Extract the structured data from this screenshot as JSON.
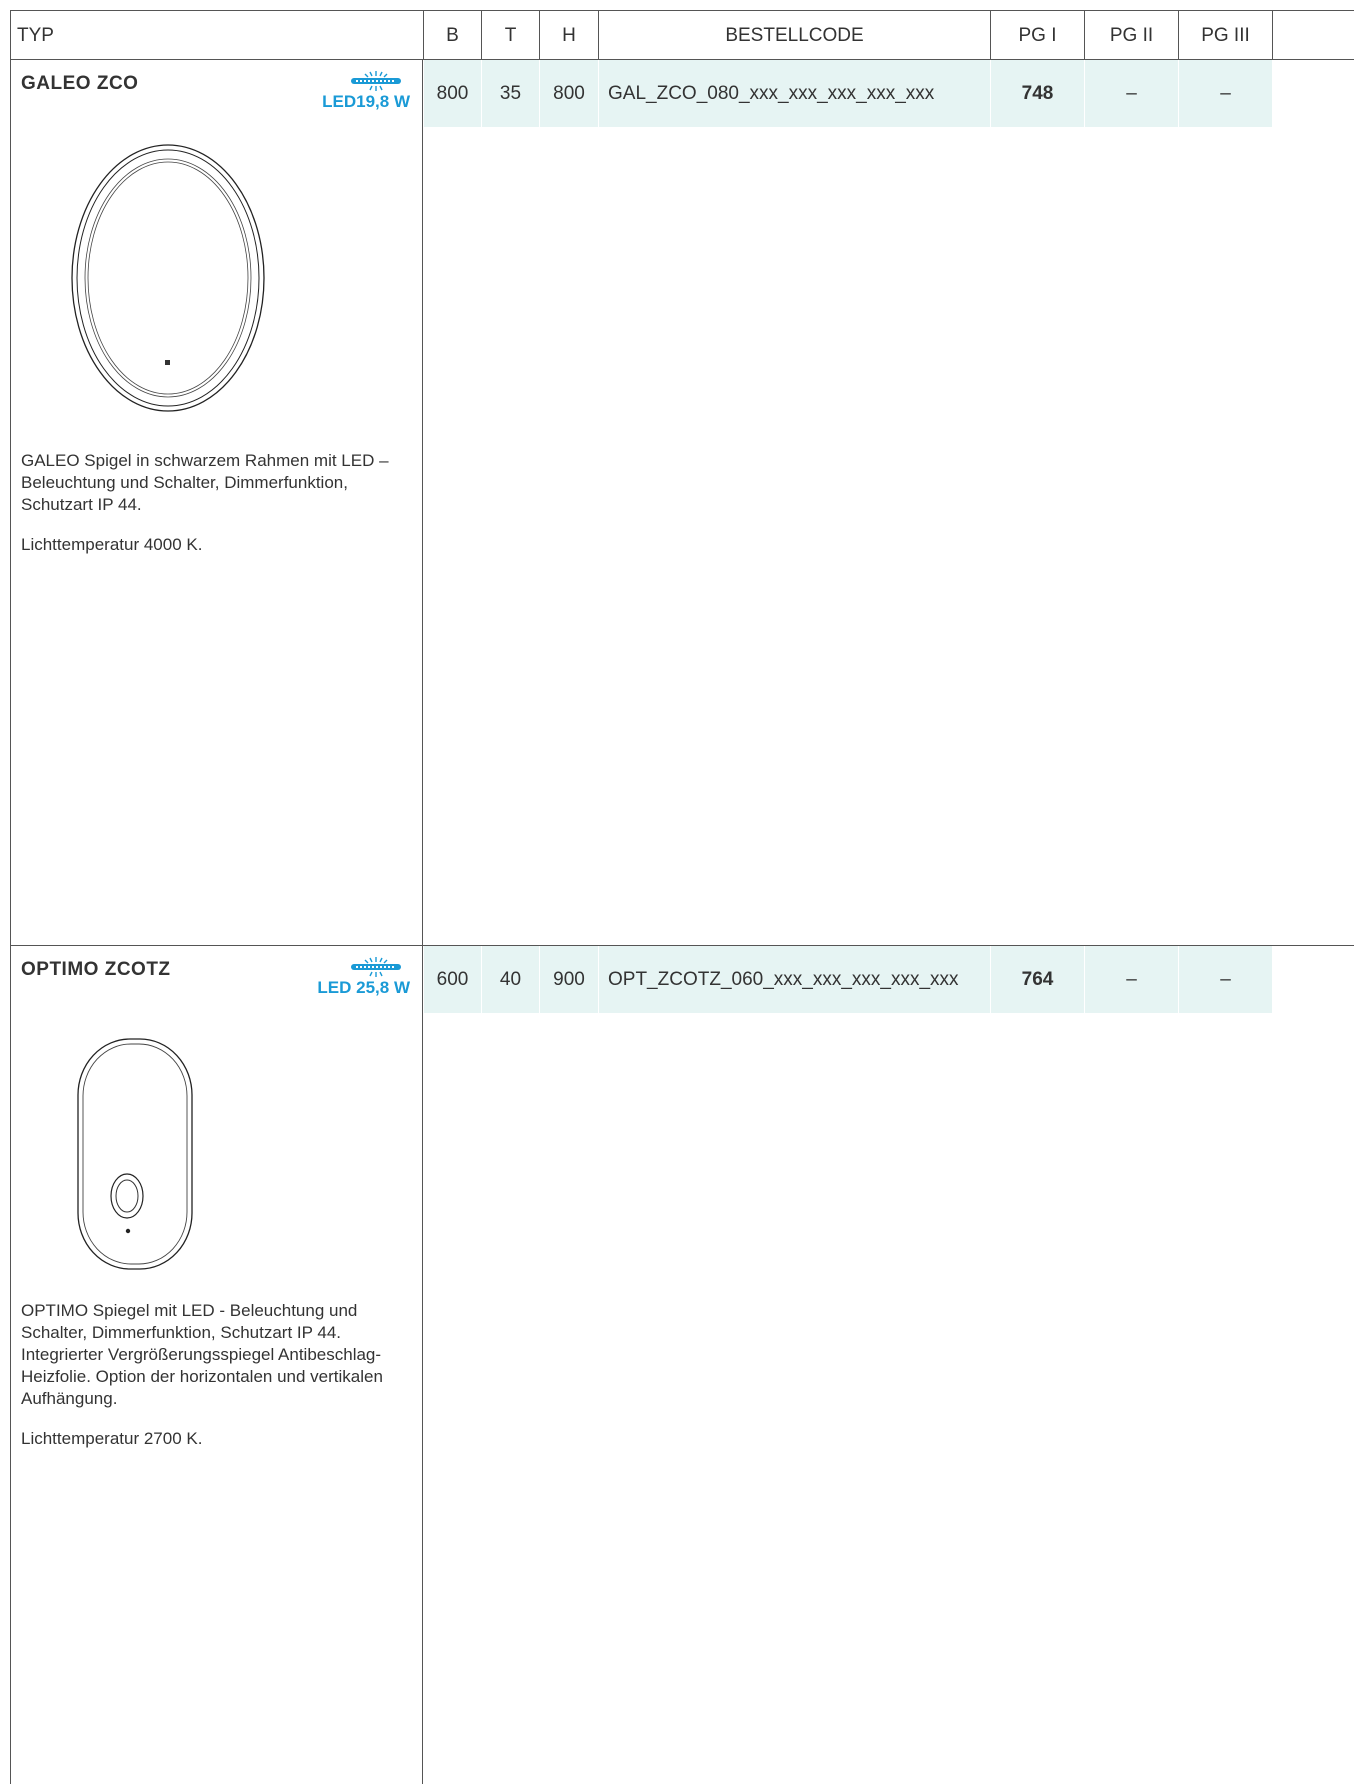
{
  "header": {
    "typ": "TYP",
    "b": "B",
    "t": "T",
    "h": "H",
    "bestellcode": "BESTELLCODE",
    "pg1": "PG I",
    "pg2": "PG II",
    "pg3": "PG III"
  },
  "products": [
    {
      "name": "GALEO ZCO",
      "led_label": "LED19,8 W",
      "icon": "led-strip-icon",
      "b": "800",
      "t": "35",
      "h": "800",
      "code": "GAL_ZCO_080_xxx_xxx_xxx_xxx_xxx",
      "pg1": "748",
      "pg2": "–",
      "pg3": "–",
      "description": [
        "GALEO Spigel in schwarzem Rahmen mit LED – Beleuchtung und Schalter, Dimmerfunktion, Schutzart IP 44.",
        "Lichttemperatur 4000 K."
      ]
    },
    {
      "name": "OPTIMO ZCOTZ",
      "led_label": "LED 25,8 W",
      "icon": "led-strip-icon",
      "b": "600",
      "t": "40",
      "h": "900",
      "code": "OPT_ZCOTZ_060_xxx_xxx_xxx_xxx_xxx",
      "pg1": "764",
      "pg2": "–",
      "pg3": "–",
      "description": [
        "OPTIMO Spiegel mit LED - Beleuchtung und Schalter, Dimmerfunktion, Schutzart IP 44. Integrierter Vergrößerungsspiegel Antibeschlag-Heizfolie. Option der horizontalen und vertikalen Aufhängung.",
        "Lichttemperatur 2700 K."
      ]
    }
  ],
  "colors": {
    "accent": "#1a9ad6",
    "row_fill": "#e6f4f3",
    "border": "#555555",
    "text": "#333333"
  }
}
